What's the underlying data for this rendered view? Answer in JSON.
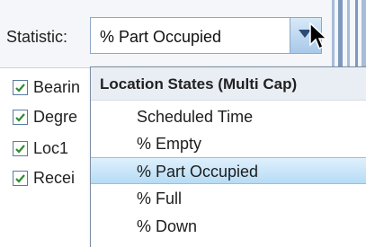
{
  "statistic": {
    "label": "Statistic:",
    "selected_value": "% Part Occupied"
  },
  "checklist": [
    {
      "label": "Bearin",
      "checked": true
    },
    {
      "label": "Degre",
      "checked": true
    },
    {
      "label": "Loc1",
      "checked": true
    },
    {
      "label": "Recei",
      "checked": true
    }
  ],
  "dropdown": {
    "group_header": "Location States (Multi Cap)",
    "options": [
      {
        "label": "Scheduled Time"
      },
      {
        "label": "% Empty"
      },
      {
        "label": "% Part Occupied"
      },
      {
        "label": "% Full"
      },
      {
        "label": "% Down"
      }
    ],
    "selected_index": 2
  },
  "colors": {
    "accent": "#b6dcf6",
    "checkmark": "#2e8b2e",
    "combo_button": "#a9c9e8"
  }
}
